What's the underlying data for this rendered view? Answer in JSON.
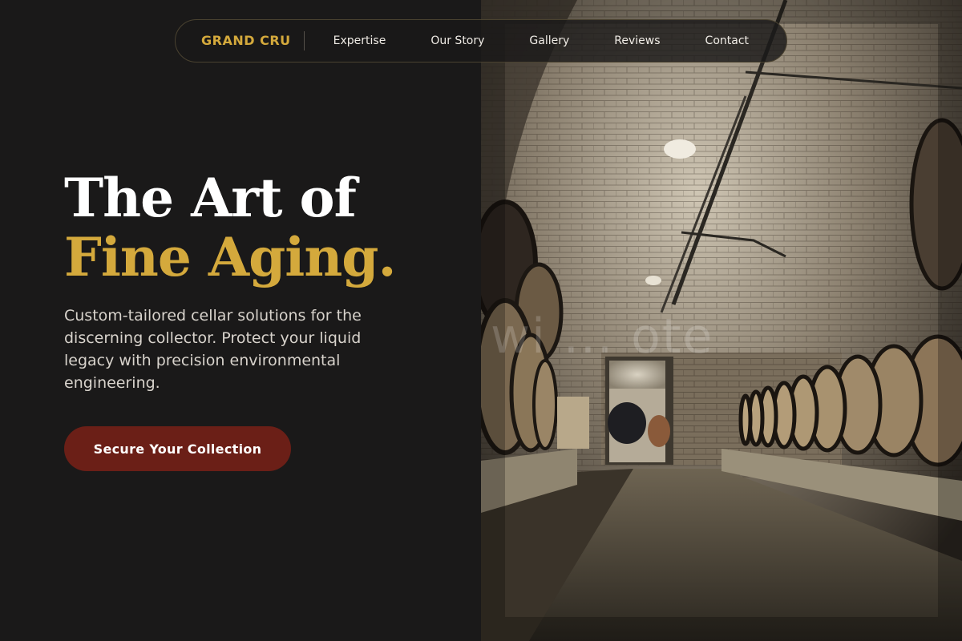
{
  "nav": {
    "brand": "GRAND CRU",
    "links": [
      "Expertise",
      "Our Story",
      "Gallery",
      "Reviews",
      "Contact"
    ]
  },
  "hero": {
    "title_line1": "The Art of",
    "title_line2": "Fine Aging.",
    "description": "Custom-tailored cellar solutions for the discerning collector. Protect your liquid legacy with precision environmental engineering.",
    "cta_label": "Secure Your Collection"
  },
  "colors": {
    "background": "#1a1919",
    "accent_gold": "#d4a93c",
    "cta_burgundy": "#6b1f17",
    "text_light": "#d8d3cc"
  },
  "photo": {
    "watermark": "wi ... ote"
  }
}
